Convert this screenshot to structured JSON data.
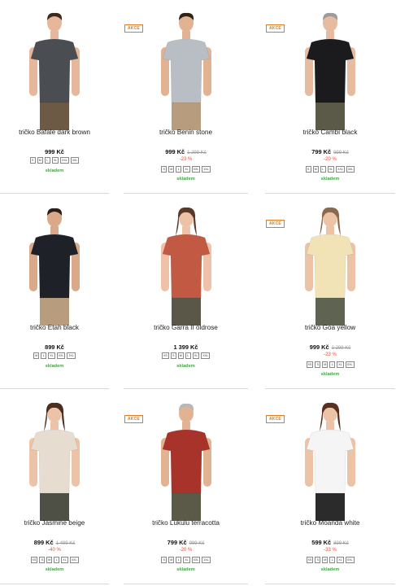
{
  "colors": {
    "badge": "#e07a1f",
    "discount": "#e0533c",
    "stock": "#3fa63f"
  },
  "products": [
    {
      "name": "tričko Bafale dark brown",
      "badge": "",
      "price": "999 Kč",
      "old_price": "",
      "discount": "",
      "sizes": [
        "S",
        "M",
        "L",
        "XL",
        "XXL",
        "3XL"
      ],
      "stock": "skladem",
      "shirt": "#4a4d52",
      "skin": "#e6b79b",
      "hair": "#3b2a20",
      "pants": "#6c5a44",
      "gender": "m"
    },
    {
      "name": "tričko Benin stone",
      "badge": "AKCE",
      "price": "999 Kč",
      "old_price": "1 299 Kč",
      "discount": "-23 %",
      "sizes": [
        "S",
        "M",
        "L",
        "XL",
        "XXL",
        "3XL"
      ],
      "stock": "skladem",
      "shirt": "#b9bec4",
      "skin": "#e2b393",
      "hair": "#2e2219",
      "pants": "#b79c7d",
      "gender": "m"
    },
    {
      "name": "tričko Cambi black",
      "badge": "AKCE",
      "price": "799 Kč",
      "old_price": "999 Kč",
      "discount": "-20 %",
      "sizes": [
        "S",
        "M",
        "L",
        "XL",
        "XXL",
        "3XL"
      ],
      "stock": "skladem",
      "shirt": "#1b1b1d",
      "skin": "#e7bba0",
      "hair": "#9b9b9b",
      "pants": "#5b5a48",
      "gender": "m"
    },
    {
      "name": "tričko Etah black",
      "badge": "",
      "price": "899 Kč",
      "old_price": "",
      "discount": "",
      "sizes": [
        "M",
        "L",
        "XL",
        "XXL",
        "3XL"
      ],
      "stock": "skladem",
      "shirt": "#1e2228",
      "skin": "#d9a98a",
      "hair": "#2a1f18",
      "pants": "#b79c7d",
      "gender": "m"
    },
    {
      "name": "tričko Garra II oldrose",
      "badge": "",
      "price": "1 399 Kč",
      "old_price": "",
      "discount": "",
      "sizes": [
        "XS",
        "S",
        "M",
        "L",
        "XL",
        "XXL"
      ],
      "stock": "skladem",
      "shirt": "#c25a43",
      "skin": "#eec2a8",
      "hair": "#5a3a26",
      "pants": "#5a5648",
      "gender": "f"
    },
    {
      "name": "tričko Goa yellow",
      "badge": "AKCE",
      "price": "999 Kč",
      "old_price": "1 299 Kč",
      "discount": "-23 %",
      "sizes": [
        "XS",
        "S",
        "M",
        "L",
        "XL",
        "XXL"
      ],
      "stock": "skladem",
      "shirt": "#f1e3b5",
      "skin": "#ecc3a6",
      "hair": "#8a6a4d",
      "pants": "#5e6352",
      "gender": "f"
    },
    {
      "name": "tričko Jasmine beige",
      "badge": "",
      "price": "899 Kč",
      "old_price": "1 499 Kč",
      "discount": "-40 %",
      "sizes": [
        "XS",
        "S",
        "M",
        "L",
        "XL",
        "XXL"
      ],
      "stock": "skladem",
      "shirt": "#e6dccf",
      "skin": "#ecc3a6",
      "hair": "#4a2e20",
      "pants": "#4e5045",
      "gender": "f"
    },
    {
      "name": "tričko Lukulu terracotta",
      "badge": "AKCE",
      "price": "799 Kč",
      "old_price": "999 Kč",
      "discount": "-20 %",
      "sizes": [
        "S",
        "M",
        "L",
        "XL",
        "XXL",
        "3XL"
      ],
      "stock": "skladem",
      "shirt": "#a8332a",
      "skin": "#e2b393",
      "hair": "#b8b8b8",
      "pants": "#5b5a48",
      "gender": "m"
    },
    {
      "name": "tričko Moanda white",
      "badge": "AKCE",
      "price": "599 Kč",
      "old_price": "899 Kč",
      "discount": "-33 %",
      "sizes": [
        "XS",
        "S",
        "M",
        "L",
        "XL",
        "XXL"
      ],
      "stock": "skladem",
      "shirt": "#f5f5f5",
      "skin": "#ecc3a6",
      "hair": "#5a2f1f",
      "pants": "#2b2b2b",
      "gender": "f"
    }
  ]
}
